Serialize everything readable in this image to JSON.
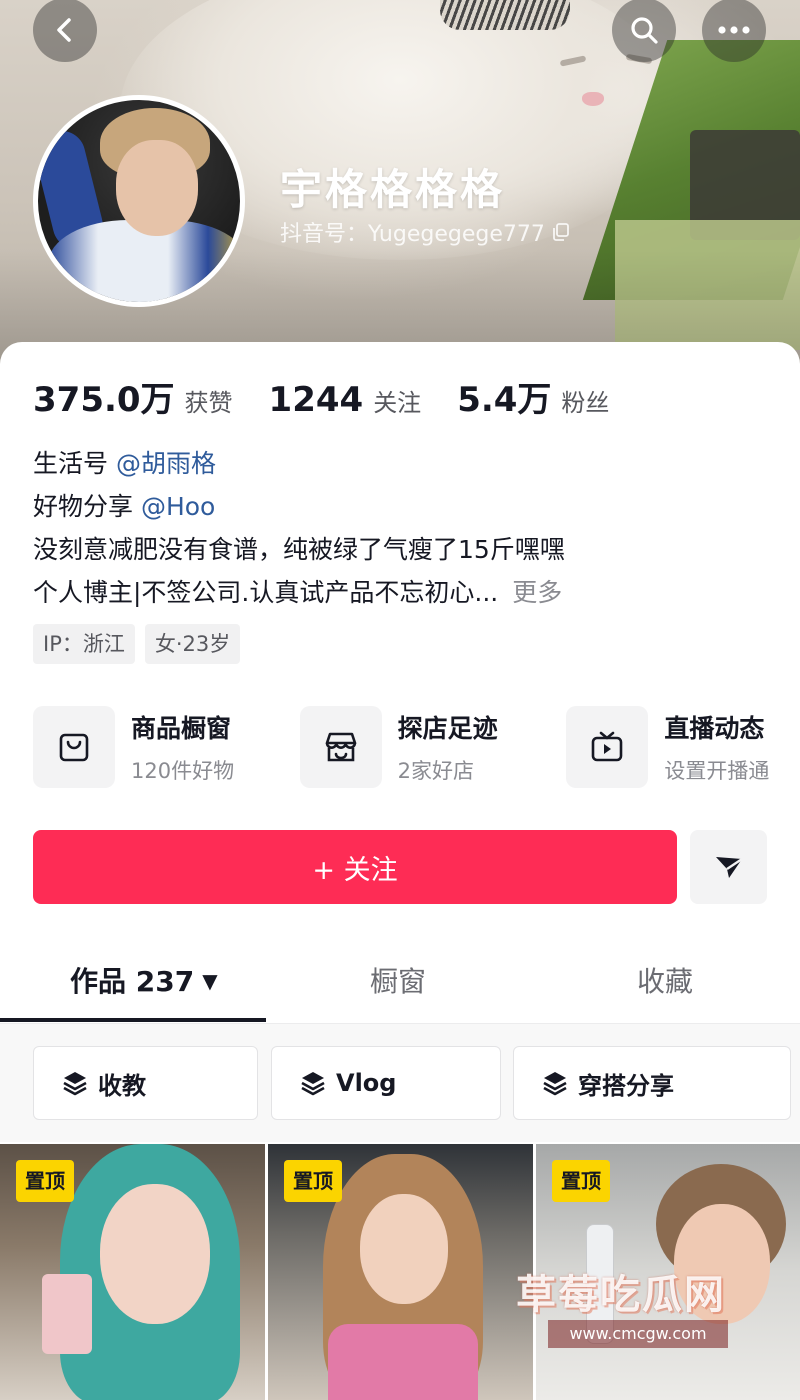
{
  "profile": {
    "nickname": "宇格格格格",
    "douyin_id": "抖音号：Yugegegege777"
  },
  "stats": [
    {
      "value": "375.0万",
      "label": "获赞"
    },
    {
      "value": "1244",
      "label": "关注"
    },
    {
      "value": "5.4万",
      "label": "粉丝"
    }
  ],
  "bio": {
    "line1_prefix": "生活号 ",
    "line1_link": "@胡雨格",
    "line2_prefix": "好物分享 ",
    "line2_link": "@Hoo",
    "line3": "没刻意减肥没有食谱，纯被绿了气瘦了15斤嘿嘿",
    "line4": "个人博主|不签公司.认真试产品不忘初心...",
    "more": "更多"
  },
  "tags": [
    "IP：浙江",
    "女·23岁"
  ],
  "features": [
    {
      "title": "商品橱窗",
      "subtitle": "120件好物",
      "icon": "bag-icon"
    },
    {
      "title": "探店足迹",
      "subtitle": "2家好店",
      "icon": "store-icon"
    },
    {
      "title": "直播动态",
      "subtitle": "设置开播通",
      "icon": "tv-icon"
    }
  ],
  "actions": {
    "follow": "+ 关注"
  },
  "tabs": [
    {
      "label": "作品 237",
      "active": true
    },
    {
      "label": "橱窗",
      "active": false
    },
    {
      "label": "收藏",
      "active": false
    }
  ],
  "collections": [
    "收教",
    "Vlog",
    "穿搭分享"
  ],
  "videos": [
    {
      "badge": "置顶"
    },
    {
      "badge": "置顶"
    },
    {
      "badge": "置顶"
    }
  ],
  "watermark": {
    "title": "草莓吃瓜网",
    "url": "www.cmcgw.com"
  },
  "colors": {
    "follow_button": "#fe2c55",
    "pin_badge": "#fbd400",
    "link": "#2f5b9b"
  }
}
